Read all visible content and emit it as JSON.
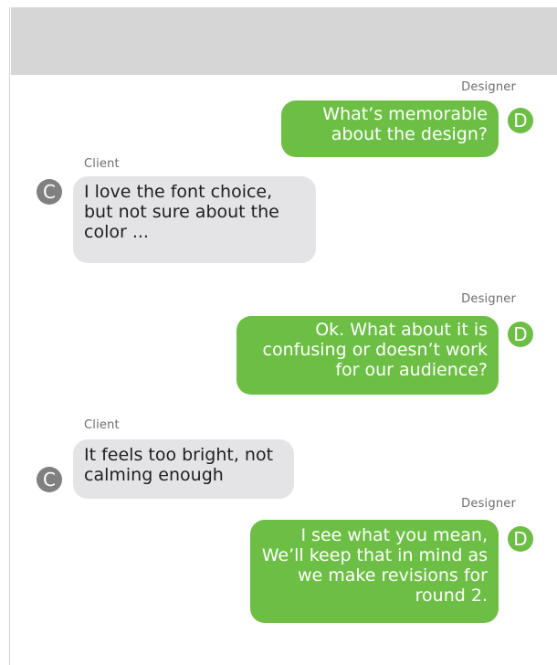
{
  "messages": [
    {
      "sender": "Designer",
      "text": "What’s memorable about the design?",
      "avatar": "D"
    },
    {
      "sender": "Client",
      "text": "I love the font choice, but not sure about the color ...",
      "avatar": "C"
    },
    {
      "sender": "Designer",
      "text": "Ok. What about it is confusing or doesn’t work for our audience?",
      "avatar": "D"
    },
    {
      "sender": "Client",
      "text": "It feels too bright, not calming enough",
      "avatar": "C"
    },
    {
      "sender": "Designer",
      "text": "I see what you mean, We’ll keep that in mind as we make revisions for round 2.",
      "avatar": "D"
    }
  ],
  "colors": {
    "designer_bubble": "#6cbf44",
    "client_bubble": "#e4e4e6",
    "client_avatar": "#808080",
    "header": "#d6d6d6"
  }
}
